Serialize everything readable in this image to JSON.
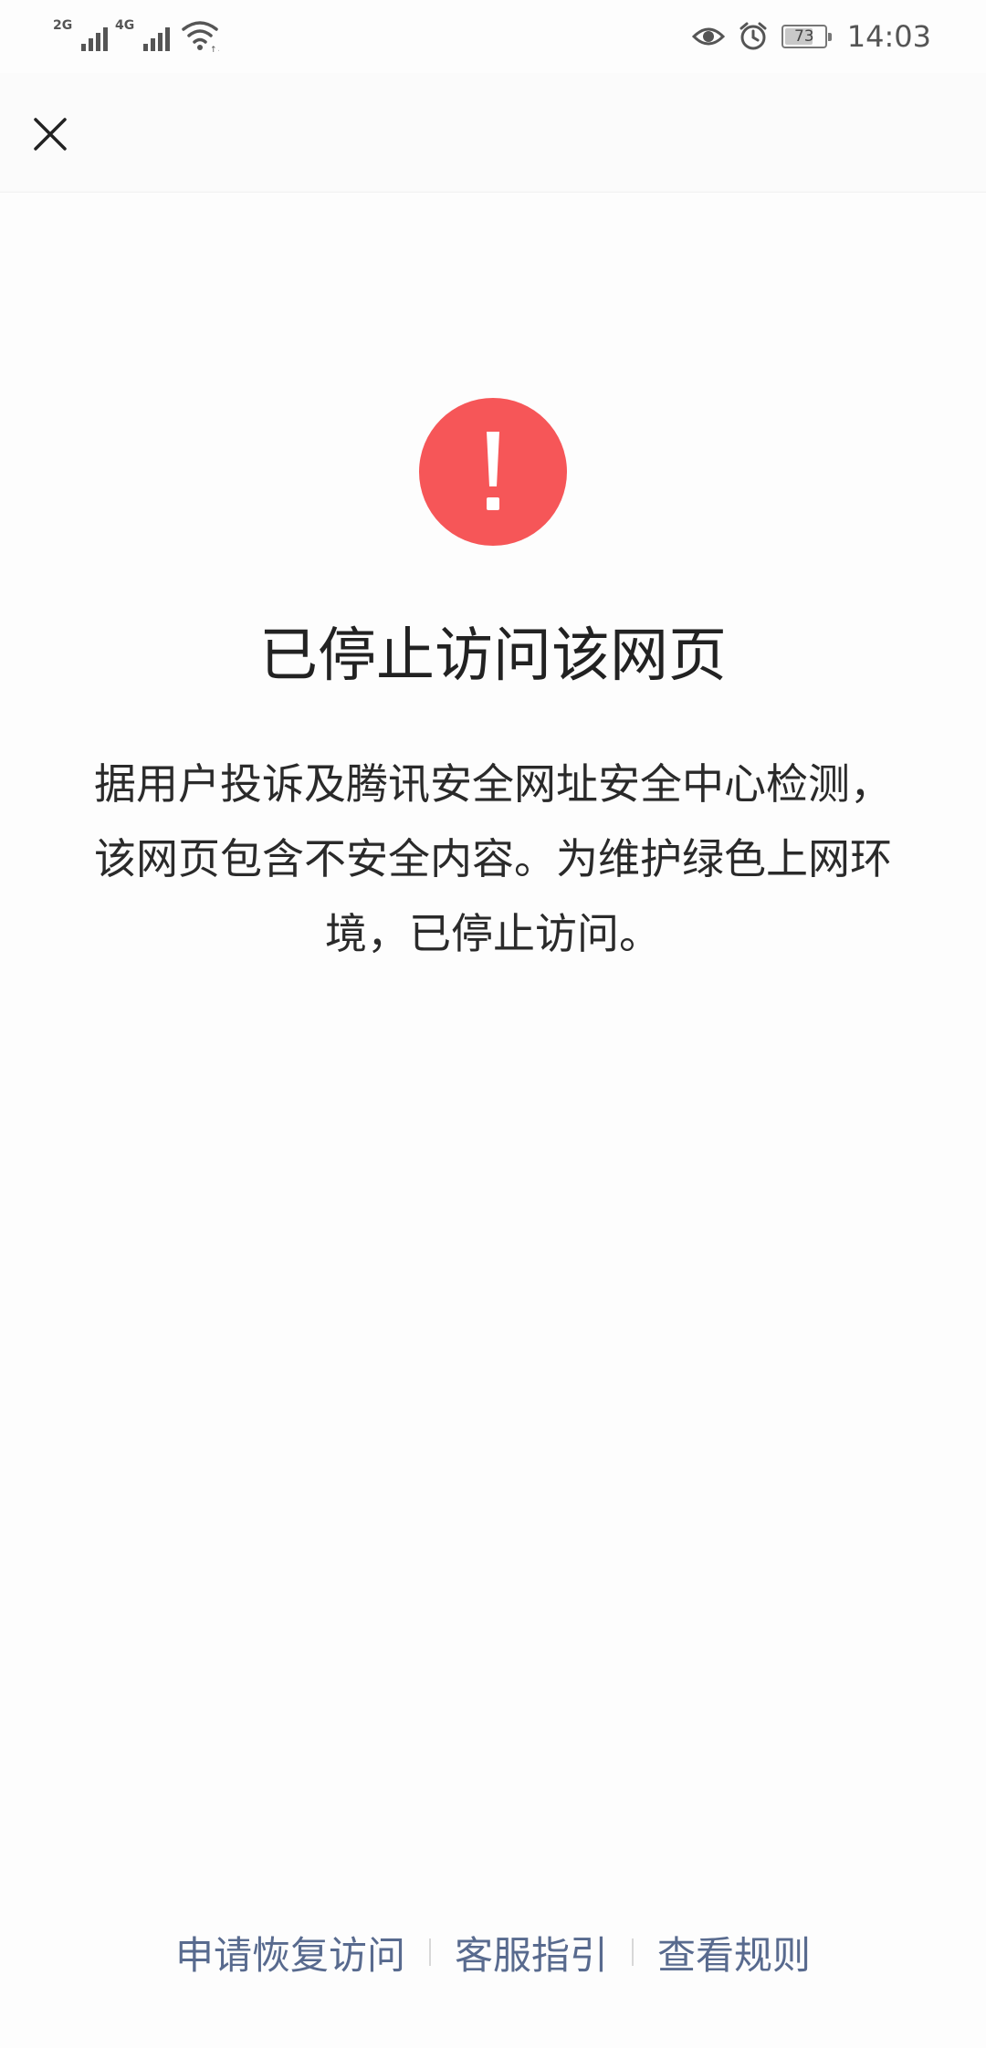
{
  "status_bar": {
    "network1": "2G",
    "network2": "4G",
    "battery_level": "73",
    "battery_fraction": 0.73,
    "time": "14:03",
    "icons": [
      "signal-icon",
      "wifi-icon",
      "eye-icon",
      "alarm-icon",
      "battery-icon"
    ]
  },
  "nav": {
    "close_icon": "close-icon"
  },
  "main": {
    "icon": "exclamation-icon",
    "icon_color": "#f65658",
    "title": "已停止访问该网页",
    "description": "据用户投诉及腾讯安全网址安全中心检测，该网页包含不安全内容。为维护绿色上网环境，已停止访问。"
  },
  "footer": {
    "link1": "申请恢复访问",
    "link2": "客服指引",
    "link3": "查看规则",
    "link_color": "#586a8e"
  }
}
